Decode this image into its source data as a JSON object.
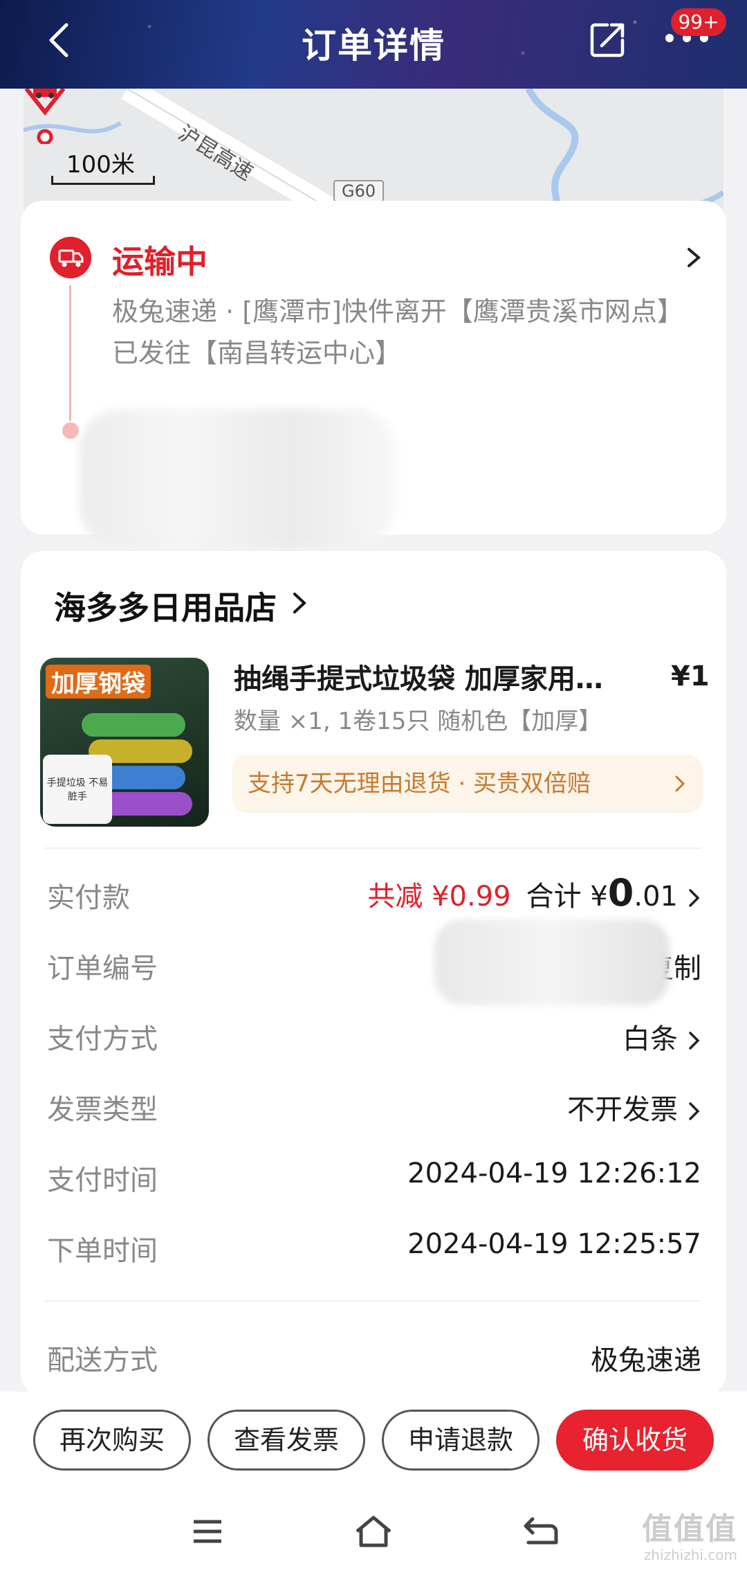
{
  "header": {
    "title": "订单详情",
    "badge": "99+"
  },
  "map": {
    "scale_label": "100米",
    "road_label": "沪昆高速",
    "highway_label": "G60"
  },
  "status": {
    "title": "运输中",
    "detail": "极兔速递 · [鹰潭市]快件离开【鹰潭贵溪市网点】已发往【南昌转运中心】"
  },
  "store": {
    "name": "海多多日用品店"
  },
  "product": {
    "image_label": "加厚钢袋",
    "image_note": "手提垃圾 不易脏手",
    "name": "抽绳手提式垃圾袋 加厚家用…",
    "price": "¥1",
    "spec": "数量 ×1, 1卷15只 随机色【加厚】",
    "guarantee": "支持7天无理由退货 · 买贵双倍赔"
  },
  "details": {
    "paid": {
      "label": "实付款",
      "discount": "共减 ¥0.99",
      "total_prefix": "合计 ¥",
      "total_int": "0",
      "total_dec": ".01"
    },
    "order_no": {
      "label": "订单编号",
      "value_start": "2",
      "copy": "复制"
    },
    "pay_method": {
      "label": "支付方式",
      "value": "白条"
    },
    "invoice_type": {
      "label": "发票类型",
      "value": "不开发票"
    },
    "pay_time": {
      "label": "支付时间",
      "value": "2024-04-19 12:26:12"
    },
    "order_time": {
      "label": "下单时间",
      "value": "2024-04-19 12:25:57"
    },
    "delivery": {
      "label": "配送方式",
      "value": "极兔速递"
    }
  },
  "actions": {
    "rebuy": "再次购买",
    "view_invoice": "查看发票",
    "refund": "申请退款",
    "confirm": "确认收货"
  },
  "watermark": {
    "main": "值值值",
    "sub": "zhizhizhi.com"
  },
  "colors": {
    "accent": "#e0202b",
    "guarantee_bg": "#fdf4ea",
    "guarantee_text": "#c67a2e"
  }
}
